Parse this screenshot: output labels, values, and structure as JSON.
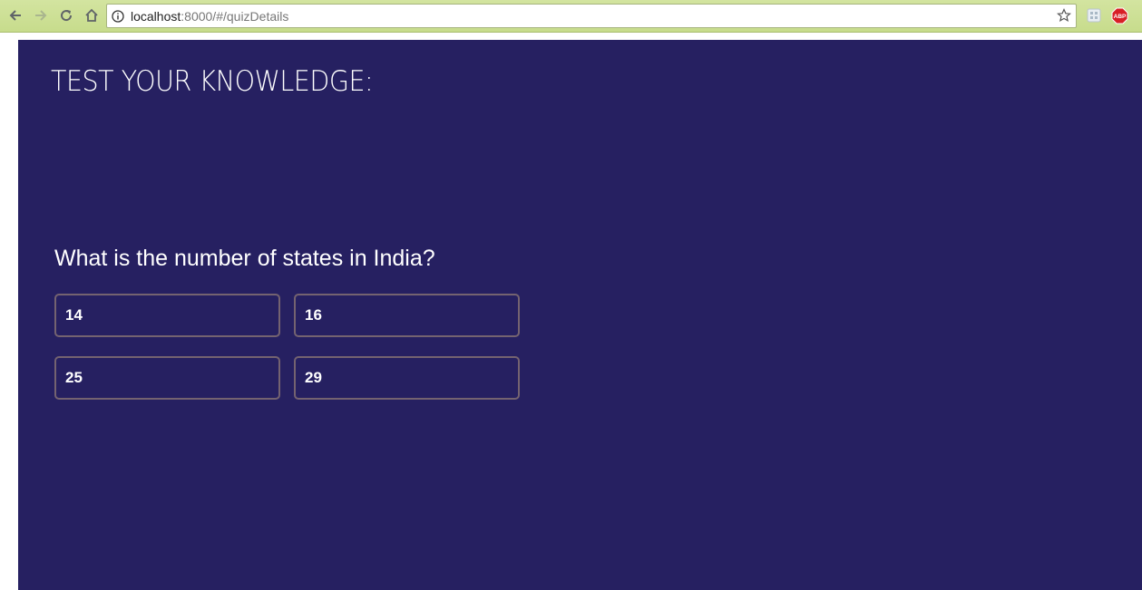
{
  "browser": {
    "url_host": "localhost",
    "url_rest": ":8000/#/quizDetails",
    "icons": [
      "back-icon",
      "forward-icon",
      "reload-icon",
      "home-icon",
      "info-icon",
      "star-icon",
      "extension-icon",
      "adblock-icon"
    ],
    "adblock_label": "ABP",
    "toolbar_color": "#c9dd92"
  },
  "quiz": {
    "title": "TEST YOUR KNOWLEDGE:",
    "question": "What is the number of states in India?",
    "options": [
      "14",
      "16",
      "25",
      "29"
    ],
    "background_color": "#262061",
    "option_border_color": "#746370"
  }
}
